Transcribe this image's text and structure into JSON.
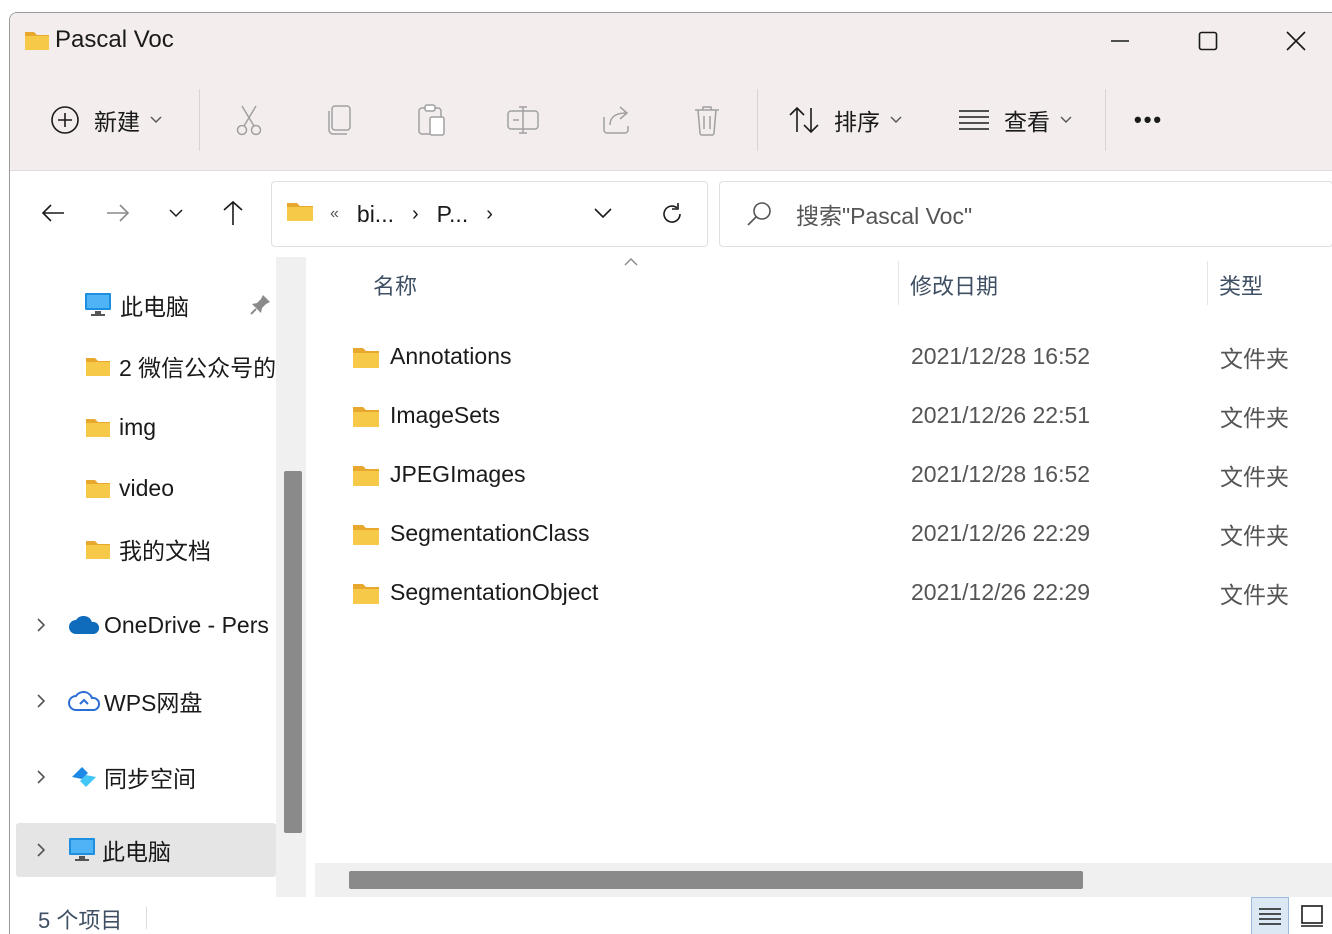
{
  "window": {
    "title": "Pascal Voc",
    "minimize_icon": "minimize-icon",
    "maximize_icon": "maximize-icon",
    "close_icon": "close-icon"
  },
  "toolbar": {
    "new_label": "新建",
    "sort_label": "排序",
    "view_label": "查看",
    "more_label": "•••",
    "icons": [
      "new-plus-icon",
      "cut-icon",
      "copy-icon",
      "paste-icon",
      "rename-icon",
      "share-icon",
      "delete-icon",
      "sort-icon",
      "view-icon",
      "more-icon"
    ]
  },
  "nav": {
    "back_icon": "arrow-left-icon",
    "forward_icon": "arrow-right-icon",
    "recent_icon": "chevron-down-icon",
    "up_icon": "arrow-up-icon",
    "overflow": "«",
    "crumbs": [
      "bi...",
      "P..."
    ],
    "refresh_icon": "refresh-icon",
    "search_placeholder": "搜索\"Pascal Voc\""
  },
  "sidebar": {
    "items": [
      {
        "label": "此电脑",
        "icon": "computer-icon",
        "pinned": true
      },
      {
        "label": "2 微信公众号的",
        "icon": "folder-icon"
      },
      {
        "label": "img",
        "icon": "folder-icon"
      },
      {
        "label": "video",
        "icon": "folder-icon"
      },
      {
        "label": "我的文档",
        "icon": "folder-icon"
      },
      {
        "label": "OneDrive - Pers",
        "icon": "onedrive-cloud-icon",
        "expandable": true
      },
      {
        "label": "WPS网盘",
        "icon": "wps-cloud-icon",
        "expandable": true
      },
      {
        "label": "同步空间",
        "icon": "sync-space-icon",
        "expandable": true
      },
      {
        "label": "此电脑",
        "icon": "computer-icon",
        "expandable": true,
        "selected": true
      }
    ]
  },
  "columns": {
    "name": "名称",
    "date": "修改日期",
    "type": "类型"
  },
  "files": [
    {
      "name": "Annotations",
      "date": "2021/12/28 16:52",
      "type": "文件夹"
    },
    {
      "name": "ImageSets",
      "date": "2021/12/26 22:51",
      "type": "文件夹"
    },
    {
      "name": "JPEGImages",
      "date": "2021/12/28 16:52",
      "type": "文件夹"
    },
    {
      "name": "SegmentationClass",
      "date": "2021/12/26 22:29",
      "type": "文件夹"
    },
    {
      "name": "SegmentationObject",
      "date": "2021/12/26 22:29",
      "type": "文件夹"
    }
  ],
  "status": {
    "count_text": "5 个项目"
  },
  "colors": {
    "chrome_bg": "#f4eded",
    "folder_yellow": "#f7c948",
    "folder_dark": "#e8a82e",
    "accent_blue": "#0f6cbd",
    "scroll_thumb": "#8a8a8a"
  }
}
